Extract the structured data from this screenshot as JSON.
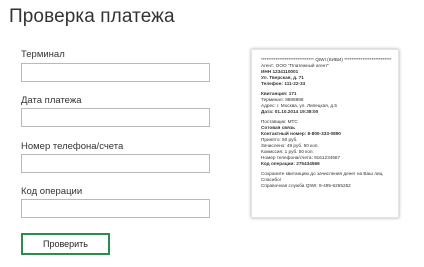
{
  "page": {
    "title": "Проверка платежа"
  },
  "form": {
    "terminal_label": "Терминал",
    "terminal_value": "",
    "date_label": "Дата платежа",
    "date_value": "",
    "phone_label": "Номер телефона/счета",
    "phone_value": "",
    "code_label": "Код операции",
    "code_value": "",
    "submit_label": "Проверить"
  },
  "receipt": {
    "header": "***************************** QIWI (КИВИ) *****************************",
    "agent": "Агент: ООО \"Платежный агент\"",
    "inn": "ИНН 1234110001",
    "street": "Ул. Тверская, д. 71",
    "phone": "Телефон: 111-22-33",
    "receipt_no": "Квитанция: 171",
    "terminal": "Терминал: 8888888",
    "address": "Адрес: г. Москва, ул. Липецкая, д.5",
    "date": "Дата: 01.10.2014 19:38:00",
    "provider": "Поставщик: МТС",
    "provider_type": "Сотовая связь",
    "contact": "Контактный номер: 8-800-333-0890",
    "accepted": "Принято: 50 руб.",
    "credited": "Зачислено: 49 руб. 50 коп.",
    "commission": "Комиссия: 1 руб. 50 коп.",
    "phone_number": "Номер телефона/счета: 9161234567",
    "operation_code": "Код операции: 275434566",
    "notice_1": "Сохраните квитанцию до зачисления денег на Ваш лиц.",
    "notice_2": "Спасибо!",
    "support": "Справочная служба QIWI: 8-495-6265252"
  }
}
